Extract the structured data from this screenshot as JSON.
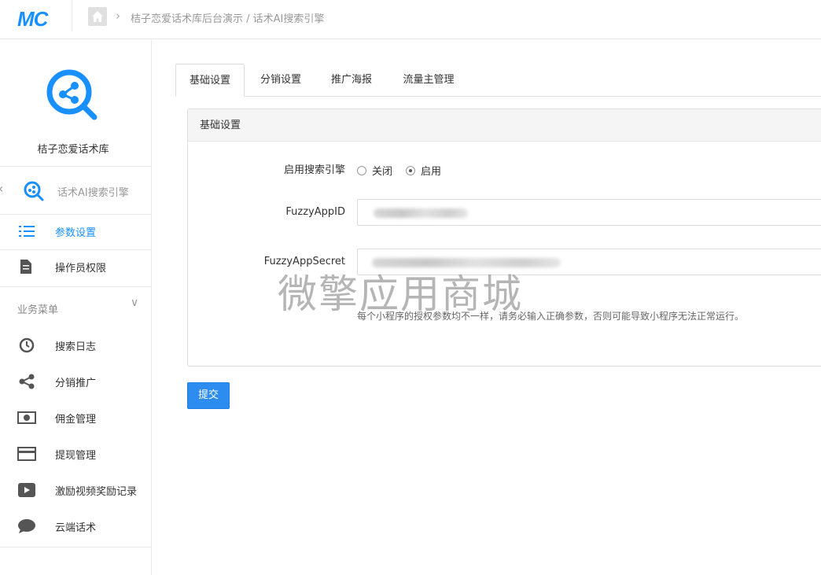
{
  "header": {
    "logo_text": "MC",
    "breadcrumb": "桔子恋爱话术库后台演示 / 话术AI搜索引擎",
    "crumb_separator": "›"
  },
  "sidebar": {
    "app_name": "桔子恋爱话术库",
    "back_arrow": "‹",
    "plugin_label": "话术AI搜索引擎",
    "items_top": [
      {
        "label": "参数设置",
        "icon": "list-icon",
        "active": true
      },
      {
        "label": "操作员权限",
        "icon": "document-icon",
        "active": false
      }
    ],
    "group_title": "业务菜单",
    "group_chevron": "∨",
    "group_items": [
      {
        "label": "搜索日志",
        "icon": "history-icon"
      },
      {
        "label": "分销推广",
        "icon": "share-icon"
      },
      {
        "label": "佣金管理",
        "icon": "money-icon"
      },
      {
        "label": "提现管理",
        "icon": "card-icon"
      },
      {
        "label": "激励视频奖励记录",
        "icon": "video-icon"
      },
      {
        "label": "云端话术",
        "icon": "chat-icon"
      }
    ]
  },
  "tabs": [
    {
      "label": "基础设置",
      "active": true
    },
    {
      "label": "分销设置",
      "active": false
    },
    {
      "label": "推广海报",
      "active": false
    },
    {
      "label": "流量主管理",
      "active": false
    }
  ],
  "panel": {
    "title": "基础设置",
    "enable_label": "启用搜索引擎",
    "radio_off": "关闭",
    "radio_on": "启用",
    "enabled": true,
    "appid_label": "FuzzyAppID",
    "secret_label": "FuzzyAppSecret",
    "hint": "每个小程序的授权参数均不一样，请务必输入正确参数，否则可能导致小程序无法正常运行。"
  },
  "watermark": "微擎应用商城",
  "submit_label": "提交",
  "colors": {
    "accent": "#1890ff",
    "button": "#2d8cf0"
  }
}
